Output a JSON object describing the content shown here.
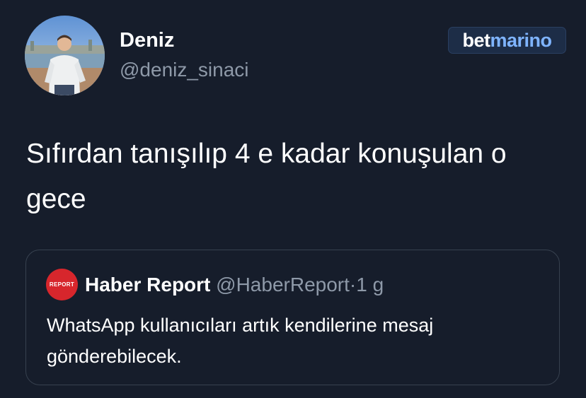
{
  "author": {
    "display_name": "Deniz",
    "handle": "@deniz_sinaci"
  },
  "watermark": {
    "part1": "bet",
    "part2": "marino",
    "colors": {
      "part1": "#ffffff",
      "part2": "#7fb4ff"
    }
  },
  "tweet": {
    "text": "Sıfırdan tanışılıp 4 e kadar konuşulan o gece"
  },
  "quoted_tweet": {
    "avatar_label": "REPORT",
    "display_name": "Haber Report",
    "handle": "@HaberReport",
    "separator": "·",
    "time": "1 g",
    "text": "WhatsApp kullanıcıları artık kendilerine mesaj gönderebilecek."
  },
  "colors": {
    "background": "#161d2b",
    "text_primary": "#ffffff",
    "text_secondary": "#8e99a8",
    "card_border": "#37414f",
    "report_red": "#d7262c"
  }
}
